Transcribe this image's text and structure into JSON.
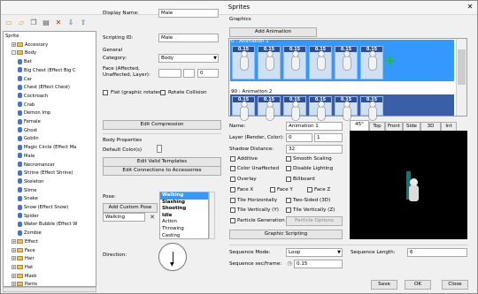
{
  "window": {
    "title": "Sprites",
    "close_glyph": "✕"
  },
  "toolbar": {
    "icons": [
      "new-folder-icon",
      "open-folder-icon",
      "copy-icon",
      "paste-icon",
      "delete-icon",
      "import-icon",
      "export-icon"
    ]
  },
  "tree": {
    "items": [
      {
        "label": "Sprite",
        "level": 0,
        "kind": "root"
      },
      {
        "label": "Accessory",
        "level": 1,
        "kind": "folder",
        "exp": "+"
      },
      {
        "label": "Body",
        "level": 1,
        "kind": "folder",
        "exp": "-"
      },
      {
        "label": "Bat",
        "level": 2,
        "kind": "item"
      },
      {
        "label": "Big Chest (Effect Big C",
        "level": 2,
        "kind": "item"
      },
      {
        "label": "Car",
        "level": 2,
        "kind": "item"
      },
      {
        "label": "Chest (Effect Chest)",
        "level": 2,
        "kind": "item"
      },
      {
        "label": "Cockroach",
        "level": 2,
        "kind": "item"
      },
      {
        "label": "Crab",
        "level": 2,
        "kind": "item"
      },
      {
        "label": "Demon Imp",
        "level": 2,
        "kind": "item"
      },
      {
        "label": "Female",
        "level": 2,
        "kind": "item"
      },
      {
        "label": "Ghost",
        "level": 2,
        "kind": "item"
      },
      {
        "label": "Goblin",
        "level": 2,
        "kind": "item"
      },
      {
        "label": "Magic Circle (Effect Ma",
        "level": 2,
        "kind": "item"
      },
      {
        "label": "Male",
        "level": 2,
        "kind": "item"
      },
      {
        "label": "Necromancer",
        "level": 2,
        "kind": "item"
      },
      {
        "label": "Shrine (Effect Shrine)",
        "level": 2,
        "kind": "item"
      },
      {
        "label": "Skeleton",
        "level": 2,
        "kind": "item"
      },
      {
        "label": "Slime",
        "level": 2,
        "kind": "item"
      },
      {
        "label": "Snake",
        "level": 2,
        "kind": "item"
      },
      {
        "label": "Snow (Effect Snow)",
        "level": 2,
        "kind": "item"
      },
      {
        "label": "Spider",
        "level": 2,
        "kind": "item"
      },
      {
        "label": "Water Bubble (Effect W",
        "level": 2,
        "kind": "item"
      },
      {
        "label": "Zombie",
        "level": 2,
        "kind": "item"
      },
      {
        "label": "Effect",
        "level": 1,
        "kind": "folder",
        "exp": "+"
      },
      {
        "label": "Face",
        "level": 1,
        "kind": "folder",
        "exp": "+"
      },
      {
        "label": "Hair",
        "level": 1,
        "kind": "folder",
        "exp": "+"
      },
      {
        "label": "Hat",
        "level": 1,
        "kind": "folder",
        "exp": "+"
      },
      {
        "label": "Mask",
        "level": 1,
        "kind": "folder",
        "exp": "+"
      },
      {
        "label": "Pants",
        "level": 1,
        "kind": "folder",
        "exp": "+"
      }
    ]
  },
  "props": {
    "display_name_label": "Display Name:",
    "display_name": "Male",
    "scripting_id_label": "Scripting ID:",
    "scripting_id": "Male",
    "general_label": "General",
    "category_label": "Category:",
    "category": "Body",
    "face_label": "Face (Affected, Unaffected, Layer):",
    "face_layer": "0",
    "flat_label": "Flat (graphic rotates)",
    "rotate_collision_label": "Rotate Collision",
    "edit_compression": "Edit Compression",
    "body_properties_label": "Body Properties",
    "default_colors_label": "Default Color(s)",
    "edit_valid_templates": "Edit Valid Templates",
    "edit_connections": "Edit Connections to Accessories",
    "pose_label": "Pose:",
    "add_custom_pose": "Add Custom Pose",
    "pose_value": "Walking",
    "pose_clear": "✕",
    "pose_list": [
      "Walking",
      "Slashing",
      "Shooting",
      "Idle",
      "Action",
      "Throwing",
      "Casting"
    ],
    "direction_label": "Direction:"
  },
  "graphics": {
    "title": "Graphics",
    "add_animation": "Add Animation",
    "anim1_label": "0 : Animation 1",
    "anim2_label": "90 : Animation 2",
    "frame_time": "0.15",
    "add_frame_glyph": "+",
    "name_label": "Name:",
    "name_value": "Animation 1",
    "layer_label": "Layer (Render, Color):",
    "layer_render": "0",
    "layer_color": "1",
    "shadow_label": "Shadow Distance:",
    "shadow_value": "32",
    "additive": "Additive",
    "smooth_scaling": "Smooth Scaling",
    "color_unaffected": "Color Unaffected",
    "disable_lighting": "Disable Lighting",
    "overlay": "Overlay",
    "billboard": "Billboard",
    "face_x": "Face X",
    "face_y": "Face Y",
    "face_z": "Face Z",
    "tile_h": "Tile Horizontally",
    "two_sided": "Two-Sided (3D)",
    "tile_v": "Tile Vertically (Y)",
    "tile_vz": "Tile Vertically (Z)",
    "particle_gen": "Particle Generation",
    "particle_options": "Particle Options",
    "graphic_scripting": "Graphic Scripting",
    "tabs": [
      "45°",
      "Top",
      "Front",
      "Side",
      "3D",
      "Int"
    ],
    "sequence_mode_label": "Sequence Mode:",
    "sequence_mode": "Loop",
    "sequence_length_label": "Sequence Length:",
    "sequence_length": "6",
    "sec_frame_label": "Sequence sec/frame:",
    "sec_frame": "0.15"
  },
  "footer": {
    "save": "Save",
    "ok": "OK",
    "close": "Close"
  }
}
